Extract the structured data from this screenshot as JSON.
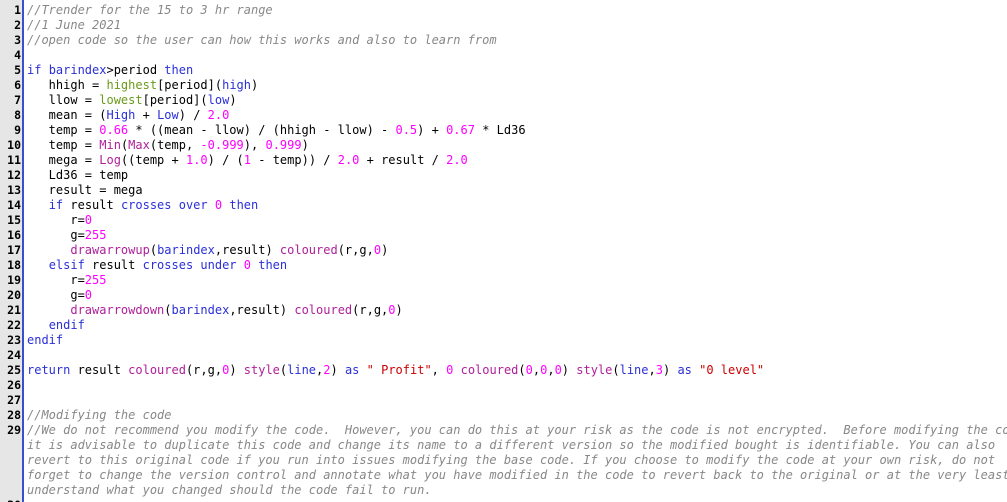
{
  "colors": {
    "gutter_bg": "#e6e6e6",
    "gutter_border": "#3a4fd0",
    "comment": "#888888",
    "keyword": "#2a2fd8",
    "function_green": "#6a9a1a",
    "builtin_purple": "#b0209a",
    "number": "#ff00ff",
    "string": "#cc0000"
  },
  "lines": [
    {
      "n": "1",
      "parts": [
        {
          "c": "comment",
          "t": "//Trender for the 15 to 3 hr range"
        }
      ]
    },
    {
      "n": "2",
      "parts": [
        {
          "c": "comment",
          "t": "//1 June 2021"
        }
      ]
    },
    {
      "n": "3",
      "parts": [
        {
          "c": "comment",
          "t": "//open code so the user can how this works and also to learn from"
        }
      ]
    },
    {
      "n": "4",
      "parts": []
    },
    {
      "n": "5",
      "parts": [
        {
          "c": "kw",
          "t": "if"
        },
        {
          "c": "",
          "t": " "
        },
        {
          "c": "kw",
          "t": "barindex"
        },
        {
          "c": "",
          "t": ">period "
        },
        {
          "c": "kw",
          "t": "then"
        }
      ]
    },
    {
      "n": "6",
      "parts": [
        {
          "c": "",
          "t": "   hhigh = "
        },
        {
          "c": "fn",
          "t": "highest"
        },
        {
          "c": "",
          "t": "[period]("
        },
        {
          "c": "kw",
          "t": "high"
        },
        {
          "c": "",
          "t": ")"
        }
      ]
    },
    {
      "n": "7",
      "parts": [
        {
          "c": "",
          "t": "   llow = "
        },
        {
          "c": "fn",
          "t": "lowest"
        },
        {
          "c": "",
          "t": "[period]("
        },
        {
          "c": "kw",
          "t": "low"
        },
        {
          "c": "",
          "t": ")"
        }
      ]
    },
    {
      "n": "8",
      "parts": [
        {
          "c": "",
          "t": "   mean = ("
        },
        {
          "c": "kw",
          "t": "High"
        },
        {
          "c": "",
          "t": " + "
        },
        {
          "c": "kw",
          "t": "Low"
        },
        {
          "c": "",
          "t": ") / "
        },
        {
          "c": "num",
          "t": "2.0"
        }
      ]
    },
    {
      "n": "9",
      "parts": [
        {
          "c": "",
          "t": "   temp = "
        },
        {
          "c": "num",
          "t": "0.66"
        },
        {
          "c": "",
          "t": " * ((mean - llow) / (hhigh - llow) - "
        },
        {
          "c": "num",
          "t": "0.5"
        },
        {
          "c": "",
          "t": ") + "
        },
        {
          "c": "num",
          "t": "0.67"
        },
        {
          "c": "",
          "t": " * Ld36"
        }
      ]
    },
    {
      "n": "10",
      "parts": [
        {
          "c": "",
          "t": "   temp = "
        },
        {
          "c": "bi",
          "t": "Min"
        },
        {
          "c": "",
          "t": "("
        },
        {
          "c": "bi",
          "t": "Max"
        },
        {
          "c": "",
          "t": "(temp, "
        },
        {
          "c": "num",
          "t": "-0.999"
        },
        {
          "c": "",
          "t": "), "
        },
        {
          "c": "num",
          "t": "0.999"
        },
        {
          "c": "",
          "t": ")"
        }
      ]
    },
    {
      "n": "11",
      "parts": [
        {
          "c": "",
          "t": "   mega = "
        },
        {
          "c": "bi",
          "t": "Log"
        },
        {
          "c": "",
          "t": "((temp + "
        },
        {
          "c": "num",
          "t": "1.0"
        },
        {
          "c": "",
          "t": ") / ("
        },
        {
          "c": "num",
          "t": "1"
        },
        {
          "c": "",
          "t": " - temp)) / "
        },
        {
          "c": "num",
          "t": "2.0"
        },
        {
          "c": "",
          "t": " + result / "
        },
        {
          "c": "num",
          "t": "2.0"
        }
      ]
    },
    {
      "n": "12",
      "parts": [
        {
          "c": "",
          "t": "   Ld36 = temp"
        }
      ]
    },
    {
      "n": "13",
      "parts": [
        {
          "c": "",
          "t": "   result = mega"
        }
      ]
    },
    {
      "n": "14",
      "parts": [
        {
          "c": "",
          "t": "   "
        },
        {
          "c": "kw",
          "t": "if"
        },
        {
          "c": "",
          "t": " result "
        },
        {
          "c": "kw",
          "t": "crosses over"
        },
        {
          "c": "",
          "t": " "
        },
        {
          "c": "num",
          "t": "0"
        },
        {
          "c": "",
          "t": " "
        },
        {
          "c": "kw",
          "t": "then"
        }
      ]
    },
    {
      "n": "15",
      "parts": [
        {
          "c": "",
          "t": "      r="
        },
        {
          "c": "num",
          "t": "0"
        }
      ]
    },
    {
      "n": "16",
      "parts": [
        {
          "c": "",
          "t": "      g="
        },
        {
          "c": "num",
          "t": "255"
        }
      ]
    },
    {
      "n": "17",
      "parts": [
        {
          "c": "",
          "t": "      "
        },
        {
          "c": "bi",
          "t": "drawarrowup"
        },
        {
          "c": "",
          "t": "("
        },
        {
          "c": "kw",
          "t": "barindex"
        },
        {
          "c": "",
          "t": ",result) "
        },
        {
          "c": "bi",
          "t": "coloured"
        },
        {
          "c": "",
          "t": "(r,g,"
        },
        {
          "c": "num",
          "t": "0"
        },
        {
          "c": "",
          "t": ")"
        }
      ]
    },
    {
      "n": "18",
      "parts": [
        {
          "c": "",
          "t": "   "
        },
        {
          "c": "kw",
          "t": "elsif"
        },
        {
          "c": "",
          "t": " result "
        },
        {
          "c": "kw",
          "t": "crosses under"
        },
        {
          "c": "",
          "t": " "
        },
        {
          "c": "num",
          "t": "0"
        },
        {
          "c": "",
          "t": " "
        },
        {
          "c": "kw",
          "t": "then"
        }
      ]
    },
    {
      "n": "19",
      "parts": [
        {
          "c": "",
          "t": "      r="
        },
        {
          "c": "num",
          "t": "255"
        }
      ]
    },
    {
      "n": "20",
      "parts": [
        {
          "c": "",
          "t": "      g="
        },
        {
          "c": "num",
          "t": "0"
        }
      ]
    },
    {
      "n": "21",
      "parts": [
        {
          "c": "",
          "t": "      "
        },
        {
          "c": "bi",
          "t": "drawarrowdown"
        },
        {
          "c": "",
          "t": "("
        },
        {
          "c": "kw",
          "t": "barindex"
        },
        {
          "c": "",
          "t": ",result) "
        },
        {
          "c": "bi",
          "t": "coloured"
        },
        {
          "c": "",
          "t": "(r,g,"
        },
        {
          "c": "num",
          "t": "0"
        },
        {
          "c": "",
          "t": ")"
        }
      ]
    },
    {
      "n": "22",
      "parts": [
        {
          "c": "",
          "t": "   "
        },
        {
          "c": "kw",
          "t": "endif"
        }
      ]
    },
    {
      "n": "23",
      "parts": [
        {
          "c": "kw",
          "t": "endif"
        }
      ]
    },
    {
      "n": "24",
      "parts": []
    },
    {
      "n": "25",
      "parts": [
        {
          "c": "kw",
          "t": "return"
        },
        {
          "c": "",
          "t": " result "
        },
        {
          "c": "bi",
          "t": "coloured"
        },
        {
          "c": "",
          "t": "(r,g,"
        },
        {
          "c": "num",
          "t": "0"
        },
        {
          "c": "",
          "t": ") "
        },
        {
          "c": "bi",
          "t": "style"
        },
        {
          "c": "",
          "t": "("
        },
        {
          "c": "kw",
          "t": "line"
        },
        {
          "c": "",
          "t": ","
        },
        {
          "c": "num",
          "t": "2"
        },
        {
          "c": "",
          "t": ") "
        },
        {
          "c": "kw",
          "t": "as"
        },
        {
          "c": "",
          "t": " "
        },
        {
          "c": "str",
          "t": "\" Profit\""
        },
        {
          "c": "",
          "t": ", "
        },
        {
          "c": "num",
          "t": "0"
        },
        {
          "c": "",
          "t": " "
        },
        {
          "c": "bi",
          "t": "coloured"
        },
        {
          "c": "",
          "t": "("
        },
        {
          "c": "num",
          "t": "0"
        },
        {
          "c": "",
          "t": ","
        },
        {
          "c": "num",
          "t": "0"
        },
        {
          "c": "",
          "t": ","
        },
        {
          "c": "num",
          "t": "0"
        },
        {
          "c": "",
          "t": ") "
        },
        {
          "c": "bi",
          "t": "style"
        },
        {
          "c": "",
          "t": "("
        },
        {
          "c": "kw",
          "t": "line"
        },
        {
          "c": "",
          "t": ","
        },
        {
          "c": "num",
          "t": "3"
        },
        {
          "c": "",
          "t": ") "
        },
        {
          "c": "kw",
          "t": "as"
        },
        {
          "c": "",
          "t": " "
        },
        {
          "c": "str",
          "t": "\"0 level\""
        }
      ]
    },
    {
      "n": "26",
      "parts": []
    },
    {
      "n": "27",
      "parts": []
    },
    {
      "n": "28",
      "parts": [
        {
          "c": "comment",
          "t": "//Modifying the code"
        }
      ]
    },
    {
      "n": "29",
      "parts": [
        {
          "c": "comment",
          "t": "//We do not recommend you modify the code.  However, you can do this at your risk as the code is not encrypted.  Before modifying the code,"
        }
      ],
      "continuation": [
        "it is advisable to duplicate this code and change its name to a different version so the modified bought is identifiable. You can also",
        "revert to this original code if you run into issues modifying the base code. If you choose to modify the code at your own risk, do not",
        "forget to change the version control and annotate what you have modified in the code to revert back to the original or at the very least",
        "understand what you changed should the code fail to run."
      ]
    },
    {
      "n": "30",
      "parts": []
    }
  ]
}
